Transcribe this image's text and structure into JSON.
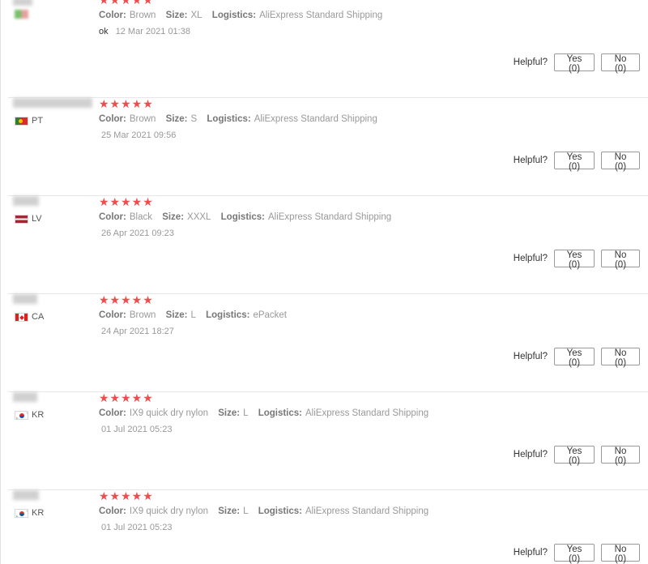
{
  "helpful_label": "Helpful?",
  "reviews": [
    {
      "country_code": "",
      "flag": "blurred-flag",
      "stars": "★★★★★",
      "color_label": "Color:",
      "color_value": "Brown",
      "size_label": "Size:",
      "size_value": "XL",
      "logistics_label": "Logistics:",
      "logistics_value": "AliExpress Standard Shipping",
      "feedback_text": "ok",
      "date": "12 Mar 2021 01:38",
      "yes_label": "Yes (0)",
      "no_label": "No (0)"
    },
    {
      "country_code": "PT",
      "flag": "portugal-flag",
      "stars": "★★★★★",
      "color_label": "Color:",
      "color_value": "Brown",
      "size_label": "Size:",
      "size_value": "S",
      "logistics_label": "Logistics:",
      "logistics_value": "AliExpress Standard Shipping",
      "feedback_text": "",
      "date": "25 Mar 2021 09:56",
      "yes_label": "Yes (0)",
      "no_label": "No (0)"
    },
    {
      "country_code": "LV",
      "flag": "latvia-flag",
      "stars": "★★★★★",
      "color_label": "Color:",
      "color_value": "Black",
      "size_label": "Size:",
      "size_value": "XXXL",
      "logistics_label": "Logistics:",
      "logistics_value": "AliExpress Standard Shipping",
      "feedback_text": "",
      "date": "26 Apr 2021 09:23",
      "yes_label": "Yes (0)",
      "no_label": "No (0)"
    },
    {
      "country_code": "CA",
      "flag": "canada-flag",
      "stars": "★★★★★",
      "color_label": "Color:",
      "color_value": "Brown",
      "size_label": "Size:",
      "size_value": "L",
      "logistics_label": "Logistics:",
      "logistics_value": "ePacket",
      "feedback_text": "",
      "date": "24 Apr 2021 18:27",
      "yes_label": "Yes (0)",
      "no_label": "No (0)"
    },
    {
      "country_code": "KR",
      "flag": "korea-flag",
      "stars": "★★★★★",
      "color_label": "Color:",
      "color_value": "IX9 quick dry nylon",
      "size_label": "Size:",
      "size_value": "L",
      "logistics_label": "Logistics:",
      "logistics_value": "AliExpress Standard Shipping",
      "feedback_text": "",
      "date": "01 Jul 2021 05:23",
      "yes_label": "Yes (0)",
      "no_label": "No (0)"
    },
    {
      "country_code": "KR",
      "flag": "korea-flag",
      "stars": "★★★★★",
      "color_label": "Color:",
      "color_value": "IX9 quick dry nylon",
      "size_label": "Size:",
      "size_value": "L",
      "logistics_label": "Logistics:",
      "logistics_value": "AliExpress Standard Shipping",
      "feedback_text": "",
      "date": "01 Jul 2021 05:23",
      "yes_label": "Yes (0)",
      "no_label": "No (0)"
    }
  ]
}
